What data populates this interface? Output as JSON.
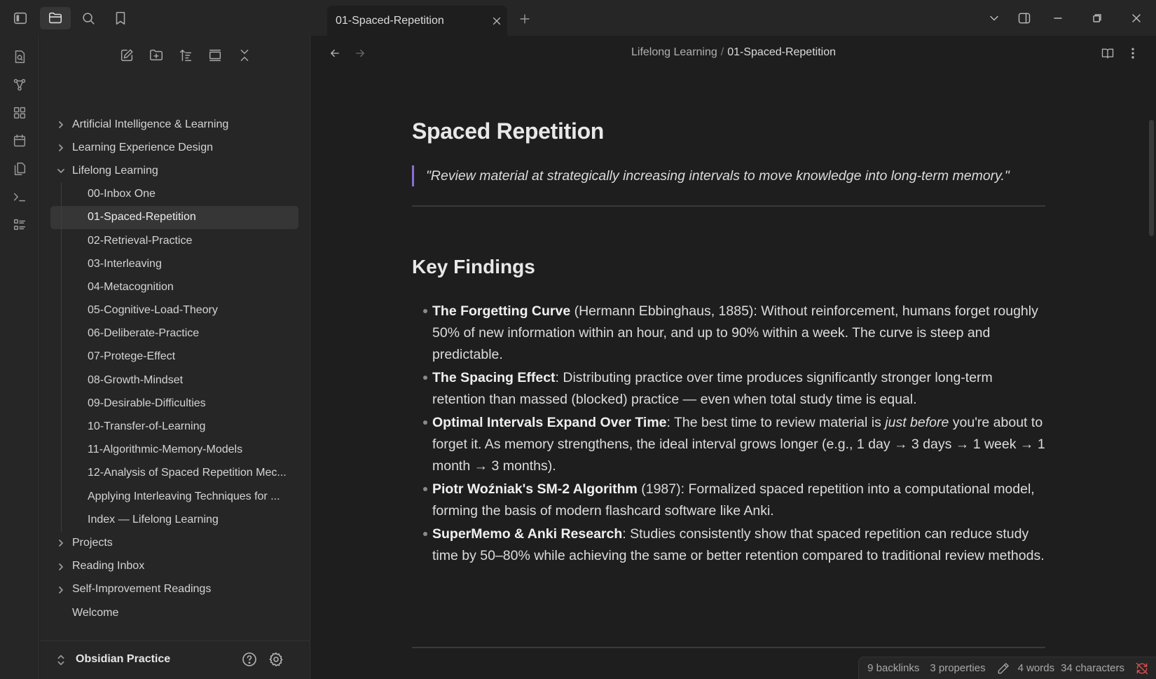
{
  "tab": {
    "title": "01-Spaced-Repetition"
  },
  "sidebar": {
    "tree": [
      {
        "type": "folder",
        "label": "Artificial Intelligence & Learning",
        "open": false
      },
      {
        "type": "folder",
        "label": "Learning Experience Design",
        "open": false
      },
      {
        "type": "folder",
        "label": "Lifelong Learning",
        "open": true
      },
      {
        "type": "file",
        "label": "00-Inbox One"
      },
      {
        "type": "file",
        "label": "01-Spaced-Repetition",
        "active": true
      },
      {
        "type": "file",
        "label": "02-Retrieval-Practice"
      },
      {
        "type": "file",
        "label": "03-Interleaving"
      },
      {
        "type": "file",
        "label": "04-Metacognition"
      },
      {
        "type": "file",
        "label": "05-Cognitive-Load-Theory"
      },
      {
        "type": "file",
        "label": "06-Deliberate-Practice"
      },
      {
        "type": "file",
        "label": "07-Protege-Effect"
      },
      {
        "type": "file",
        "label": "08-Growth-Mindset"
      },
      {
        "type": "file",
        "label": "09-Desirable-Difficulties"
      },
      {
        "type": "file",
        "label": "10-Transfer-of-Learning"
      },
      {
        "type": "file",
        "label": "11-Algorithmic-Memory-Models"
      },
      {
        "type": "file",
        "label": "12-Analysis of Spaced Repetition Mec..."
      },
      {
        "type": "file",
        "label": "Applying Interleaving Techniques for ..."
      },
      {
        "type": "file",
        "label": "Index — Lifelong Learning"
      },
      {
        "type": "folder",
        "label": "Projects",
        "open": false
      },
      {
        "type": "folder",
        "label": "Reading Inbox",
        "open": false
      },
      {
        "type": "folder",
        "label": "Self-Improvement Readings",
        "open": false
      },
      {
        "type": "root-file",
        "label": "Welcome"
      }
    ],
    "vault_name": "Obsidian Practice"
  },
  "breadcrumb": {
    "parent": "Lifelong Learning",
    "separator": "/",
    "current": "01-Spaced-Repetition"
  },
  "note": {
    "title": "Spaced Repetition",
    "quote": "\"Review material at strategically increasing intervals to move knowledge into long-term memory.\"",
    "section_title": "Key Findings",
    "findings": [
      {
        "bold": "The Forgetting Curve",
        "text": " (Hermann Ebbinghaus, 1885): Without reinforcement, humans forget roughly 50% of new information within an hour, and up to 90% within a week. The curve is steep and predictable."
      },
      {
        "bold": "The Spacing Effect",
        "text": ": Distributing practice over time produces significantly stronger long-term retention than massed (blocked) practice — even when total study time is equal."
      },
      {
        "bold": "Optimal Intervals Expand Over Time",
        "text_before": ": The best time to review material is ",
        "italic": "just before",
        "text": " you're about to forget it. As memory strengthens, the ideal interval grows longer (e.g., 1 day → 3 days → 1 week → 1 month → 3 months)."
      },
      {
        "bold": "Piotr Woźniak's SM-2 Algorithm",
        "text": " (1987): Formalized spaced repetition into a computational model, forming the basis of modern flashcard software like Anki."
      },
      {
        "bold": "SuperMemo & Anki Research",
        "text": ": Studies consistently show that spaced repetition can reduce study time by 50–80% while achieving the same or better retention compared to traditional review methods."
      }
    ]
  },
  "status": {
    "backlinks": "9 backlinks",
    "properties": "3 properties",
    "words": "4 words",
    "characters": "34 characters"
  },
  "colors": {
    "accent": "#8b6fd8",
    "sync_error": "#e05252"
  }
}
